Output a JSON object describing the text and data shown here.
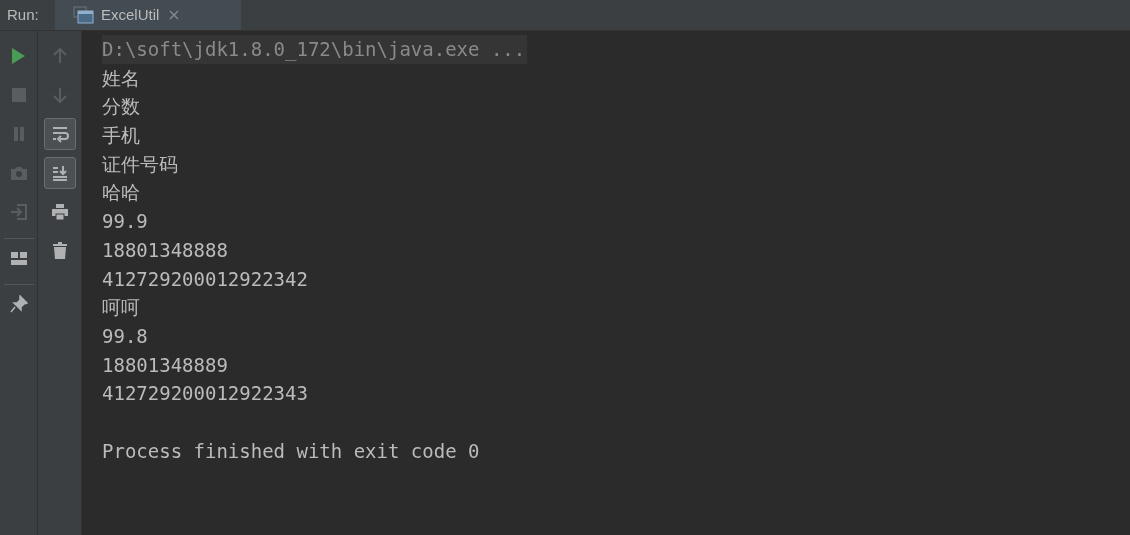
{
  "run_label": "Run:",
  "tabs": [
    {
      "label": "ExcelUtil",
      "selected": true
    }
  ],
  "left_toolbar": [
    {
      "kind": "run",
      "disabled": false
    },
    {
      "kind": "stop",
      "disabled": true
    },
    {
      "kind": "pause",
      "disabled": true
    },
    {
      "kind": "camera",
      "disabled": true
    },
    {
      "kind": "login",
      "disabled": true
    },
    {
      "kind": "layout",
      "disabled": false
    },
    {
      "kind": "pin",
      "disabled": false
    }
  ],
  "right_toolbar": [
    {
      "kind": "up",
      "disabled": true,
      "selected": false
    },
    {
      "kind": "down",
      "disabled": true,
      "selected": false
    },
    {
      "kind": "wrap",
      "disabled": false,
      "selected": true
    },
    {
      "kind": "scroll",
      "disabled": false,
      "selected": true
    },
    {
      "kind": "print",
      "disabled": false,
      "selected": false
    },
    {
      "kind": "trash",
      "disabled": false,
      "selected": false
    }
  ],
  "console": [
    {
      "kind": "command",
      "text": "D:\\soft\\jdk1.8.0_172\\bin\\java.exe ..."
    },
    {
      "kind": "output",
      "text": "姓名"
    },
    {
      "kind": "output",
      "text": "分数"
    },
    {
      "kind": "output",
      "text": "手机"
    },
    {
      "kind": "output",
      "text": "证件号码"
    },
    {
      "kind": "output",
      "text": "哈哈"
    },
    {
      "kind": "output",
      "text": "99.9"
    },
    {
      "kind": "output",
      "text": "18801348888"
    },
    {
      "kind": "output",
      "text": "412729200012922342"
    },
    {
      "kind": "output",
      "text": "呵呵"
    },
    {
      "kind": "output",
      "text": "99.8"
    },
    {
      "kind": "output",
      "text": "18801348889"
    },
    {
      "kind": "output",
      "text": "412729200012922343"
    },
    {
      "kind": "status",
      "text": "Process finished with exit code 0"
    }
  ]
}
